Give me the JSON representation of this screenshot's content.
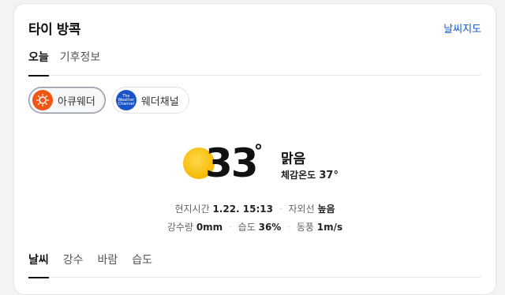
{
  "card": {
    "title": "타이 방콕",
    "map_link": "날씨지도"
  },
  "top_tabs": [
    {
      "label": "오늘",
      "active": true
    },
    {
      "label": "기후정보",
      "active": false
    }
  ],
  "sources": [
    {
      "label": "아큐웨더",
      "icon": "accuweather-logo-icon",
      "color": "#f05514",
      "active": true
    },
    {
      "label": "웨더채널",
      "icon": "weather-channel-logo-icon",
      "color": "#1a53c6",
      "active": false,
      "logo_text": "The Weather Channel"
    }
  ],
  "current": {
    "icon": "sun-icon",
    "temperature": "33",
    "degree_symbol": "°",
    "condition": "맑음",
    "feels_like_label": "체감온도",
    "feels_like_value": "37°"
  },
  "details": {
    "local_time_label": "현지시간",
    "local_time_value": "1.22. 15:13",
    "uv_label": "자외선",
    "uv_value": "높음",
    "precip_label": "강수량",
    "precip_value": "0mm",
    "humidity_label": "습도",
    "humidity_value": "36%",
    "wind_label": "동풍",
    "wind_value": "1m/s"
  },
  "bottom_tabs": [
    {
      "label": "날씨",
      "active": true
    },
    {
      "label": "강수",
      "active": false
    },
    {
      "label": "바람",
      "active": false
    },
    {
      "label": "습도",
      "active": false
    }
  ],
  "colors": {
    "link": "#0b57d0",
    "sun": "#f6b800"
  }
}
